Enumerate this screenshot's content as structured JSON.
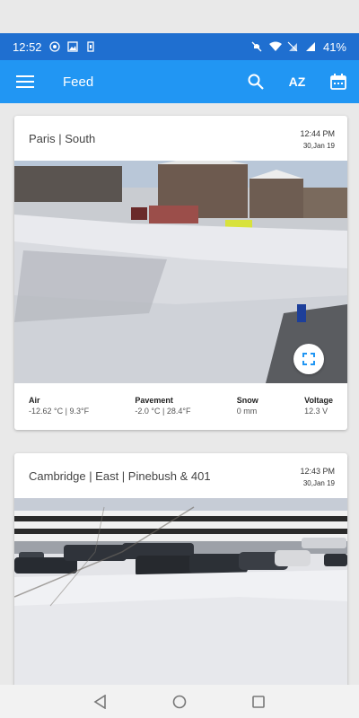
{
  "status_bar": {
    "time": "12:52",
    "battery": "41%"
  },
  "app_bar": {
    "title": "Feed",
    "sort_label": "AZ"
  },
  "cards": [
    {
      "location": "Paris | South",
      "time": "12:44 PM",
      "date": "30,Jan 19",
      "stats": [
        {
          "label": "Air",
          "value": "-12.62 °C | 9.3°F"
        },
        {
          "label": "Pavement",
          "value": "-2.0 °C | 28.4°F"
        },
        {
          "label": "Snow",
          "value": "0 mm"
        },
        {
          "label": "Voltage",
          "value": "12.3 V"
        }
      ]
    },
    {
      "location": "Cambridge | East | Pinebush & 401",
      "time": "12:43 PM",
      "date": "30,Jan 19"
    }
  ],
  "colors": {
    "status_bar": "#1f6fd0",
    "app_bar": "#2196f3"
  }
}
